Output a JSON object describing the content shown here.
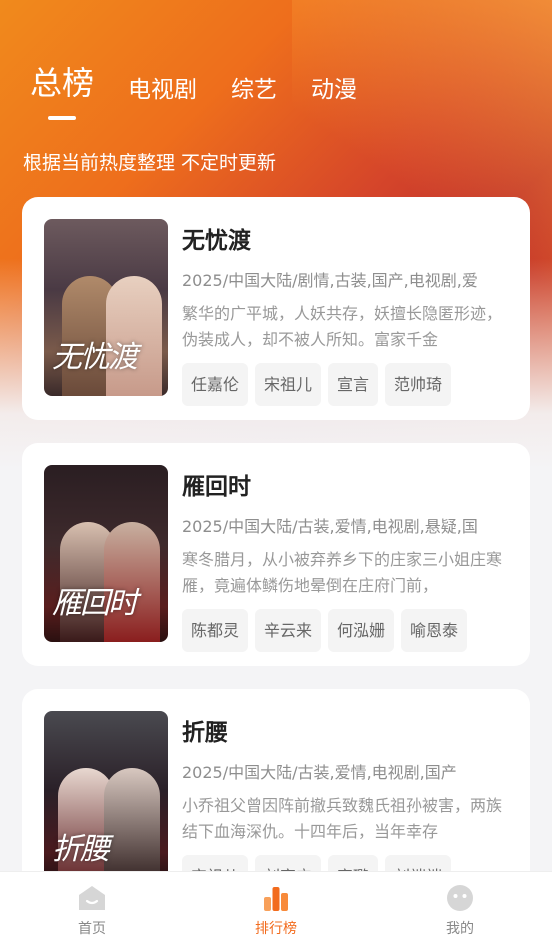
{
  "tabs": [
    "总榜",
    "电视剧",
    "综艺",
    "动漫"
  ],
  "subtitle": "根据当前热度整理 不定时更新",
  "shows": [
    {
      "title": "无忧渡",
      "poster_text": "无忧渡",
      "meta": "2025/中国大陆/剧情,古装,国产,电视剧,爱",
      "desc": "繁华的广平城，人妖共存，妖擅长隐匿形迹，伪装成人，却不被人所知。富家千金",
      "actors": [
        "任嘉伦",
        "宋祖儿",
        "宣言",
        "范帅琦"
      ]
    },
    {
      "title": "雁回时",
      "poster_text": "雁回时",
      "meta": "2025/中国大陆/古装,爱情,电视剧,悬疑,国",
      "desc": "寒冬腊月，从小被弃养乡下的庄家三小姐庄寒雁，竟遍体鳞伤地晕倒在庄府门前，",
      "actors": [
        "陈都灵",
        "辛云来",
        "何泓姗",
        "喻恩泰"
      ]
    },
    {
      "title": "折腰",
      "poster_text": "折腰",
      "meta": "2025/中国大陆/古装,爱情,电视剧,国产",
      "desc": "小乔祖父曾因阵前撤兵致魏氏祖孙被害，两族结下血海深仇。十四年后，当年幸存",
      "actors": [
        "宋祖儿",
        "刘宇宁",
        "宣璐",
        "刘端端"
      ]
    }
  ],
  "nav": [
    {
      "label": "首页",
      "icon": "home-icon"
    },
    {
      "label": "排行榜",
      "icon": "ranking-icon"
    },
    {
      "label": "我的",
      "icon": "profile-icon"
    }
  ],
  "colors": {
    "accent": "#f26b1d",
    "hero_start": "#f08a1c",
    "hero_end": "#c2342c"
  }
}
